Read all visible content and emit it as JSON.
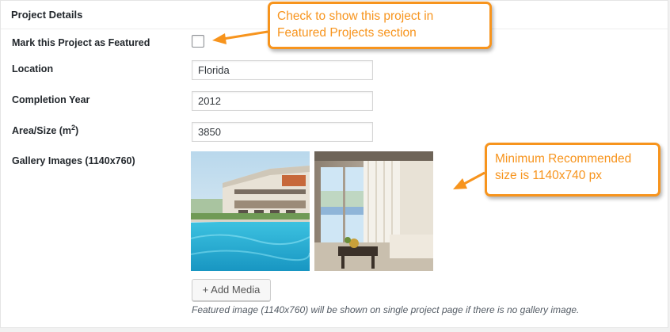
{
  "metabox": {
    "title": "Project Details"
  },
  "fields": {
    "featured": {
      "label": "Mark this Project as Featured",
      "checked": false
    },
    "location": {
      "label": "Location",
      "value": "Florida"
    },
    "completion_year": {
      "label": "Completion Year",
      "value": "2012"
    },
    "area_size": {
      "label": "Area/Size (m",
      "unit_sup": "2",
      "label_close": ")",
      "value": "3850"
    },
    "gallery": {
      "label": "Gallery Images (1140x760)",
      "images": [
        {
          "name": "resort-pool-exterior"
        },
        {
          "name": "hotel-room-interior"
        }
      ],
      "add_media_label": "+ Add Media",
      "description": "Featured image (1140x760) will be shown on single project page if there is no gallery image."
    }
  },
  "callouts": {
    "featured_note": {
      "line1": "Check to show this project in",
      "line2": "Featured Projects section"
    },
    "size_note": {
      "line1": "Minimum Recommended",
      "line2": "size is 1140x740 px"
    }
  },
  "colors": {
    "callout_accent": "#f7941d",
    "pool_water": "#2fb8d8"
  }
}
